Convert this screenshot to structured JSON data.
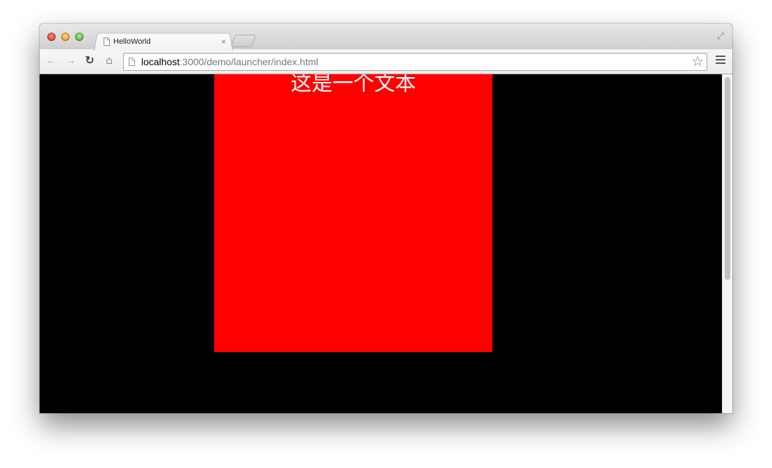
{
  "tab": {
    "title": "HelloWorld",
    "close_label": "×"
  },
  "toolbar": {
    "back_icon": "back-arrow-icon",
    "forward_icon": "forward-arrow-icon",
    "reload_icon": "reload-icon",
    "home_icon": "home-icon",
    "back_glyph": "←",
    "forward_glyph": "→",
    "reload_glyph": "↻",
    "home_glyph": "⌂"
  },
  "omnibox": {
    "url_host": "localhost",
    "url_rest": ":3000/demo/launcher/index.html",
    "star_glyph": "☆"
  },
  "page": {
    "background_color": "#000000",
    "box_color": "#ff0000",
    "text": "这是一个文本",
    "text_color": "#ffffff"
  },
  "window_controls": {
    "fullscreen_glyph": "⤢"
  }
}
